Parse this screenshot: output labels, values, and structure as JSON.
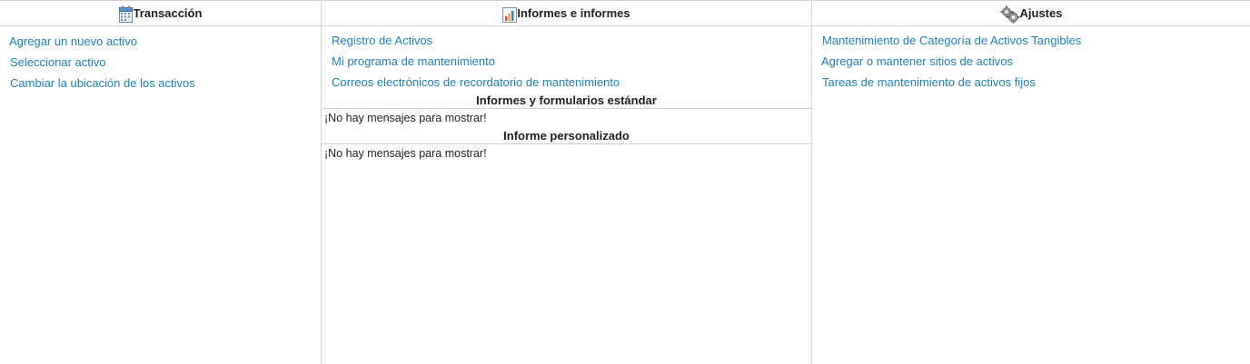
{
  "transaction": {
    "title": "Transacción",
    "icon": "calendar-icon",
    "links": [
      "Agregar un nuevo activo",
      "Seleccionar activo",
      "Cambiar la ubicación de los activos"
    ]
  },
  "reports": {
    "title": "Informes e informes",
    "icon": "chart-icon",
    "links": [
      "Registro de Activos",
      "Mi programa de mantenimiento",
      "Correos electrónicos de recordatorio de mantenimiento"
    ],
    "standard": {
      "title": "Informes y formularios estándar",
      "message": "¡No hay mensajes para mostrar!"
    },
    "custom": {
      "title": "Informe personalizado",
      "message": "¡No hay mensajes para mostrar!"
    }
  },
  "settings": {
    "title": "Ajustes",
    "icon": "gears-icon",
    "links": [
      "Mantenimiento de Categoría de Activos Tangibles",
      "Agregar o mantener sitios de activos",
      "Tareas de mantenimiento de activos fijos"
    ]
  },
  "colors": {
    "link": "#1f7fbf",
    "border": "#d2d2d2",
    "text": "#222222"
  }
}
